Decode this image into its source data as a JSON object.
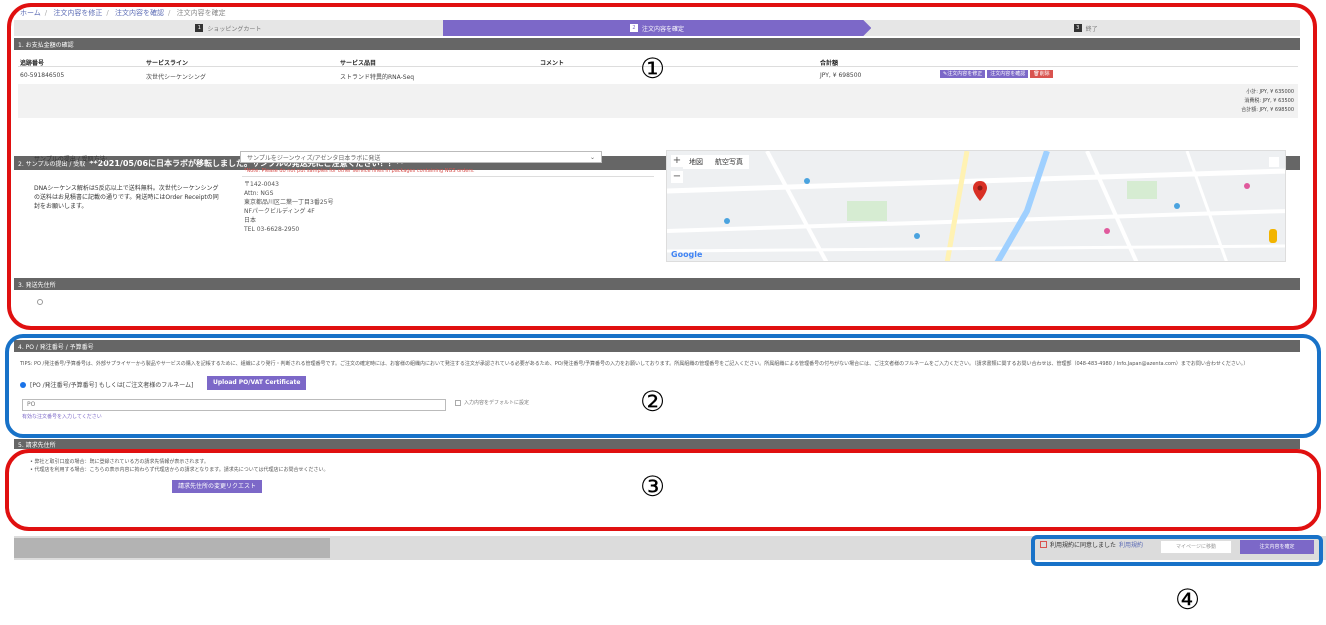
{
  "breadcrumb": {
    "home": "ホーム",
    "step1": "注文内容を修正",
    "step2": "注文内容を確認",
    "current": "注文内容を確定"
  },
  "steps": [
    {
      "num": "1",
      "label": "ショッピングカート"
    },
    {
      "num": "2",
      "label": "注文内容を確定"
    },
    {
      "num": "3",
      "label": "終了"
    }
  ],
  "section1": {
    "header": "1. お支払金額の確認",
    "columns": [
      "追跡番号",
      "サービスライン",
      "サービス品目",
      "コメント",
      "合計額"
    ],
    "row": {
      "tracking": "60-591846505",
      "service_line": "次世代シーケンシング",
      "service_item": "ストランド特異的RNA-Seq",
      "comment": "",
      "total": "JPY, ¥ 698500"
    },
    "buttons": {
      "edit": "✎注文内容を修正",
      "confirm": "注文内容を確認",
      "delete": "🗑削除"
    },
    "totals": {
      "subtotal": "小計: JPY, ¥ 635000",
      "tax": "消費税: JPY, ¥ 63500",
      "grand": "合計額: JPY, ¥ 698500"
    }
  },
  "section2": {
    "header_prefix": "2. サンプルの提出 / 受取",
    "header_notice": "**2021/05/06に日本ラボが移転しました。サンプルの発送先にご注意ください！！**",
    "method_label": "サンプルの提出 / 受取方法:",
    "method_value": "サンプルをジーンウィズ/アゼンタ日本ラボに発送",
    "note": "*Note: Please do not put samples for other service lines in packages containing NGS orders.",
    "info_text": "DNAシーケンス解析は5反応以上で送料無料。次世代シーケンシングの送料はお見積書に記載の通りです。発送時にはOrder Receiptの同封をお願いします。",
    "address": [
      "〒142-0043",
      "Attn: NGS",
      "東京都品川区二葉一丁目3番25号",
      "NFパークビルディング 4F",
      "日本",
      "TEL 03-6628-2950"
    ],
    "map": {
      "tab_map": "地図",
      "tab_satellite": "航空写真",
      "zoom_in": "+",
      "zoom_out": "−",
      "google": "Google"
    }
  },
  "section3": {
    "header": "3. 発送先住所"
  },
  "section4": {
    "header": "4. PO / 発注番号 / 予算番号",
    "tips": "TIPS: PO /発注番号/予算番号は、外部サプライヤーから製品やサービスの購入を記帳するために、組織により発行・判断される管理番号です。ご注文の確定時には、お客様の組織内において発注する注文が承認されている必要があるため、PO/発注番号/予算番号の入力をお願いしております。所属組織の管理番号をご記入ください。所属組織による管理番号の付与がない場合には、ご注文者様のフルネームをご入力ください。（請求書類に関するお問い合わせは、管理部（048-483-4980 / Info.Japan@azenta.com）までお問い合わせください。）",
    "radio_label": "[PO /発注番号/予算番号] もしくは[ご注文者様のフルネーム]",
    "upload_button": "Upload PO/VAT Certificate",
    "input_value": "PO",
    "default_label": "入力内容をデフォルトに設定",
    "error": "有効な注文番号を入力してください"
  },
  "section5": {
    "header": "5. 請求先住所",
    "bullet1": "弊社と取引口座の場合：既に登録されている方の請求先情報が表示されます。",
    "bullet2": "代理店を利用する場合：こちらの表示内容に拘わらず代理店からの請求となります。請求先については代理店にお問合せください。",
    "request_button": "請求先住所の変更リクエスト"
  },
  "footer": {
    "agree_text": "利用規約に同意しました",
    "terms_link": "利用規約",
    "mypage_button": "マイページに移動",
    "confirm_button": "注文内容を確定"
  },
  "callouts": {
    "c1": "①",
    "c2": "②",
    "c3": "③",
    "c4": "④"
  },
  "colors": {
    "accent": "#7c68c8",
    "header": "#666666",
    "red_frame": "#e01010",
    "blue_frame": "#1872c8"
  }
}
